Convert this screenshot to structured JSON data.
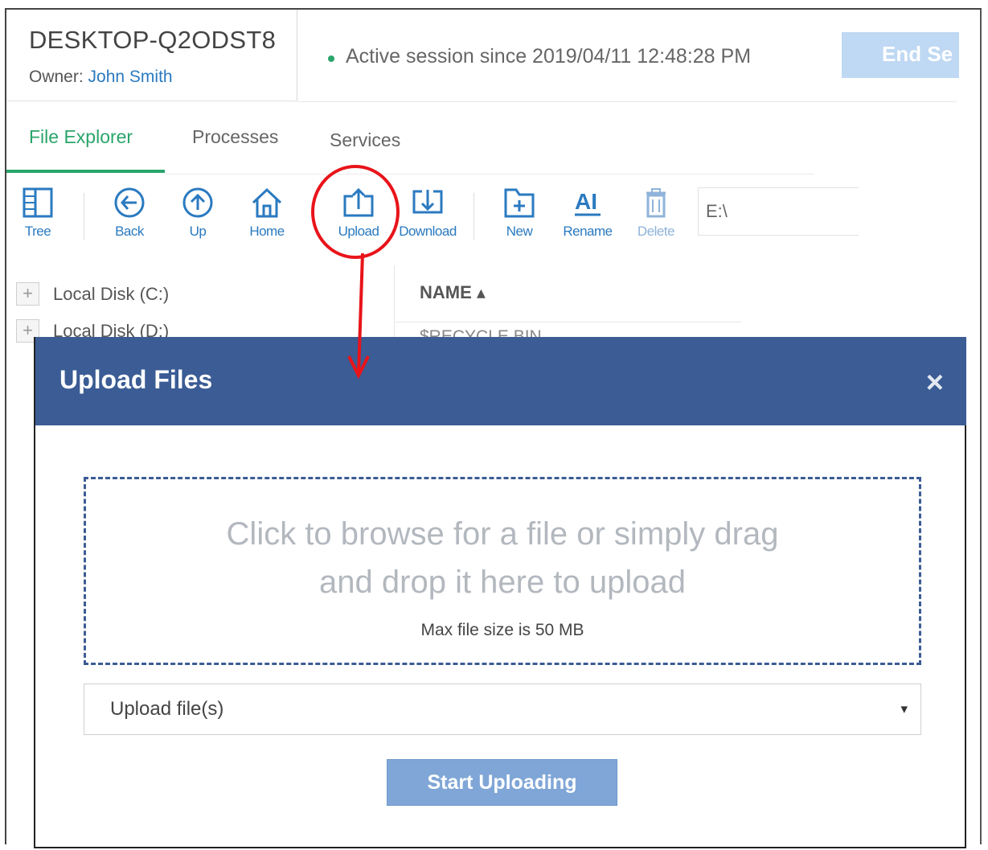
{
  "header": {
    "hostname": "DESKTOP-Q2ODST8",
    "owner_label": "Owner:",
    "owner_name": "John Smith",
    "session_text": "Active session since 2019/04/11 12:48:28 PM",
    "end_session_label": "End Se"
  },
  "tabs": [
    {
      "label": "File Explorer",
      "active": true
    },
    {
      "label": "Processes",
      "active": false
    },
    {
      "label": "Services",
      "active": false
    }
  ],
  "toolbar": {
    "tree": "Tree",
    "back": "Back",
    "up": "Up",
    "home": "Home",
    "upload": "Upload",
    "download": "Download",
    "new": "New",
    "rename": "Rename",
    "delete": "Delete",
    "path_value": "E:\\"
  },
  "tree": {
    "items": [
      {
        "label": "Local Disk (C:)"
      },
      {
        "label": "Local Disk (D:)"
      }
    ]
  },
  "file_list": {
    "column_name": "NAME ▴",
    "first_row": "$RECYCLE.BIN"
  },
  "dialog": {
    "title": "Upload Files",
    "close_symbol": "×",
    "drop_text_line1": "Click to browse for a file or simply drag",
    "drop_text_line2": "and drop it here to upload",
    "max_size_text": "Max file size is 50 MB",
    "upload_mode_selected": "Upload file(s)",
    "caret": "▾",
    "start_button": "Start Uploading"
  },
  "colors": {
    "accent_green": "#2aa56b",
    "link_blue": "#2a7ac0",
    "dialog_header": "#3b5c94",
    "annotation_red": "#e8141a",
    "start_button": "#7fa6d6"
  }
}
